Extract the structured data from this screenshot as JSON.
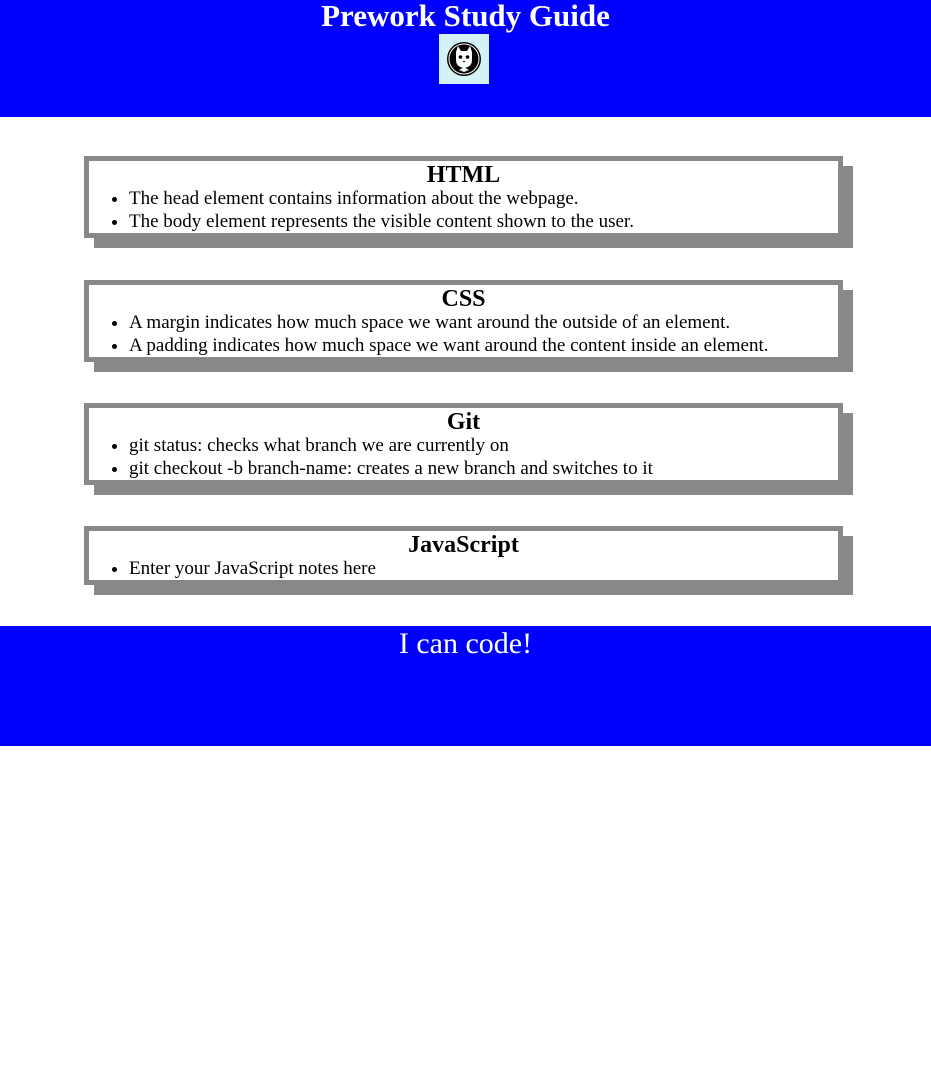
{
  "header": {
    "title": "Prework Study Guide",
    "logo_icon": "cat-face-icon"
  },
  "cards": [
    {
      "title": "HTML",
      "items": [
        "The head element contains information about the webpage.",
        "The body element represents the visible content shown to the user."
      ]
    },
    {
      "title": "CSS",
      "items": [
        "A margin indicates how much space we want around the outside of an element.",
        "A padding indicates how much space we want around the content inside an element."
      ]
    },
    {
      "title": "Git",
      "items": [
        "git status: checks what branch we are currently on",
        "git checkout -b branch-name: creates a new branch and switches to it"
      ]
    },
    {
      "title": "JavaScript",
      "items": [
        "Enter your JavaScript notes here"
      ]
    }
  ],
  "footer": {
    "text": "I can code!"
  },
  "colors": {
    "header_bg": "#0000ff",
    "footer_bg": "#0000ff",
    "card_border": "#888888",
    "logo_bg": "#d4f1f4"
  }
}
